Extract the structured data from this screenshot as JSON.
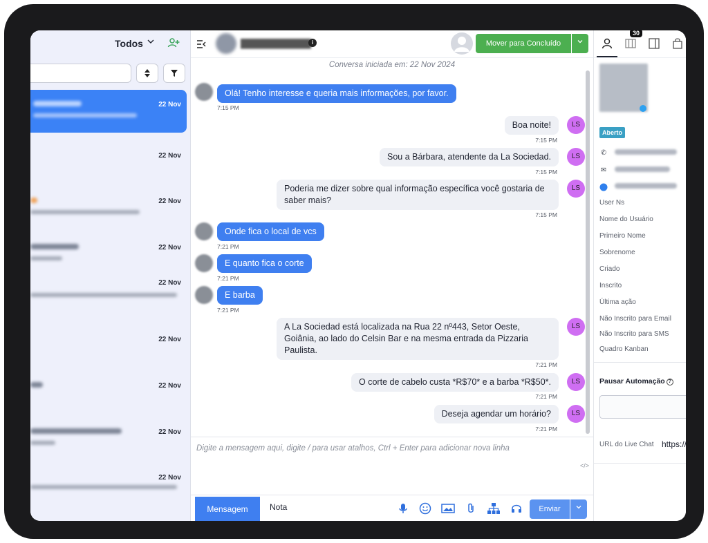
{
  "sidebar": {
    "filter_label": "Todos",
    "conversations": [
      {
        "date": "22 Nov",
        "active": true
      },
      {
        "date": "22 Nov"
      },
      {
        "date": "22 Nov"
      },
      {
        "date": "22 Nov"
      },
      {
        "date": "22 Nov"
      },
      {
        "date": "22 Nov"
      },
      {
        "date": "22 Nov"
      },
      {
        "date": "22 Nov"
      },
      {
        "date": "22 Nov"
      }
    ]
  },
  "header": {
    "move_button": "Mover para Concluído"
  },
  "chat": {
    "started_text": "Conversa iniciada em: 22 Nov 2024",
    "agent_initials": "LS",
    "messages": [
      {
        "dir": "in",
        "text": "Olá! Tenho interesse e queria mais informações, por favor.",
        "time": "7:15 PM"
      },
      {
        "dir": "out",
        "text": "Boa noite!",
        "time": "7:15 PM"
      },
      {
        "dir": "out",
        "text": "Sou a Bárbara, atendente da La Sociedad.",
        "time": "7:15 PM"
      },
      {
        "dir": "out",
        "text": "Poderia me dizer sobre qual informação específica você gostaria de saber mais?",
        "time": "7:15 PM"
      },
      {
        "dir": "in",
        "text": "Onde fica o local de vcs",
        "time": "7:21 PM"
      },
      {
        "dir": "in",
        "text": "E quanto fica o corte",
        "time": "7:21 PM"
      },
      {
        "dir": "in",
        "text": "E barba",
        "time": "7:21 PM"
      },
      {
        "dir": "out",
        "text": "A La Sociedad está localizada na Rua 22 nº443, Setor Oeste, Goiânia, ao lado do Celsin Bar e na mesma entrada da Pizzaria Paulista.",
        "time": "7:21 PM"
      },
      {
        "dir": "out",
        "text": "O corte de cabelo custa *R$70* e a barba *R$50*.",
        "time": "7:21 PM"
      },
      {
        "dir": "out",
        "text": "Deseja agendar um horário?",
        "time": "7:21 PM"
      }
    ]
  },
  "composer": {
    "placeholder": "Digite a mensagem aqui, digite / para usar atalhos, Ctrl + Enter para adicionar nova linha",
    "code_label": "</>",
    "tab_message": "Mensagem",
    "tab_note": "Nota",
    "send_label": "Enviar"
  },
  "details": {
    "badge_count": "30",
    "status": "Aberto",
    "fields": [
      "User Ns",
      "Nome do Usuário",
      "Primeiro Nome",
      "Sobrenome",
      "Criado",
      "Inscrito",
      "Última ação",
      "Não Inscrito para Email",
      "Não Inscrito para SMS",
      "Quadro Kanban"
    ],
    "pause_label": "Pausar Automação",
    "url_label": "URL do Live Chat",
    "url_value": "https://"
  },
  "colors": {
    "accent": "#3f7ff0",
    "success": "#4caf50",
    "agent_avatar": "#cf6ef2"
  }
}
